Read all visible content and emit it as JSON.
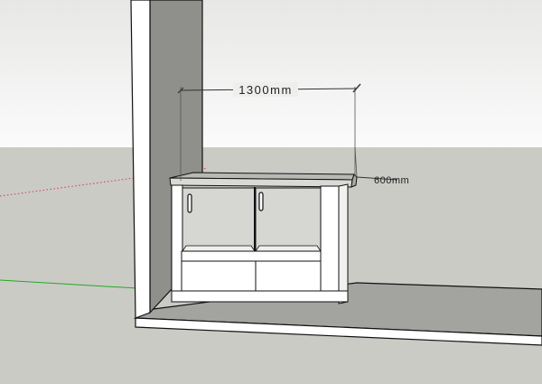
{
  "viewport": {
    "sky_color": "#fdfdfd",
    "ground_color": "#cbcbc6"
  },
  "dimensions": {
    "width_label": "1300mm",
    "depth_label": "600mm"
  },
  "axes": {
    "red_axis_color": "#d04040",
    "green_axis_color": "#22aa22"
  }
}
